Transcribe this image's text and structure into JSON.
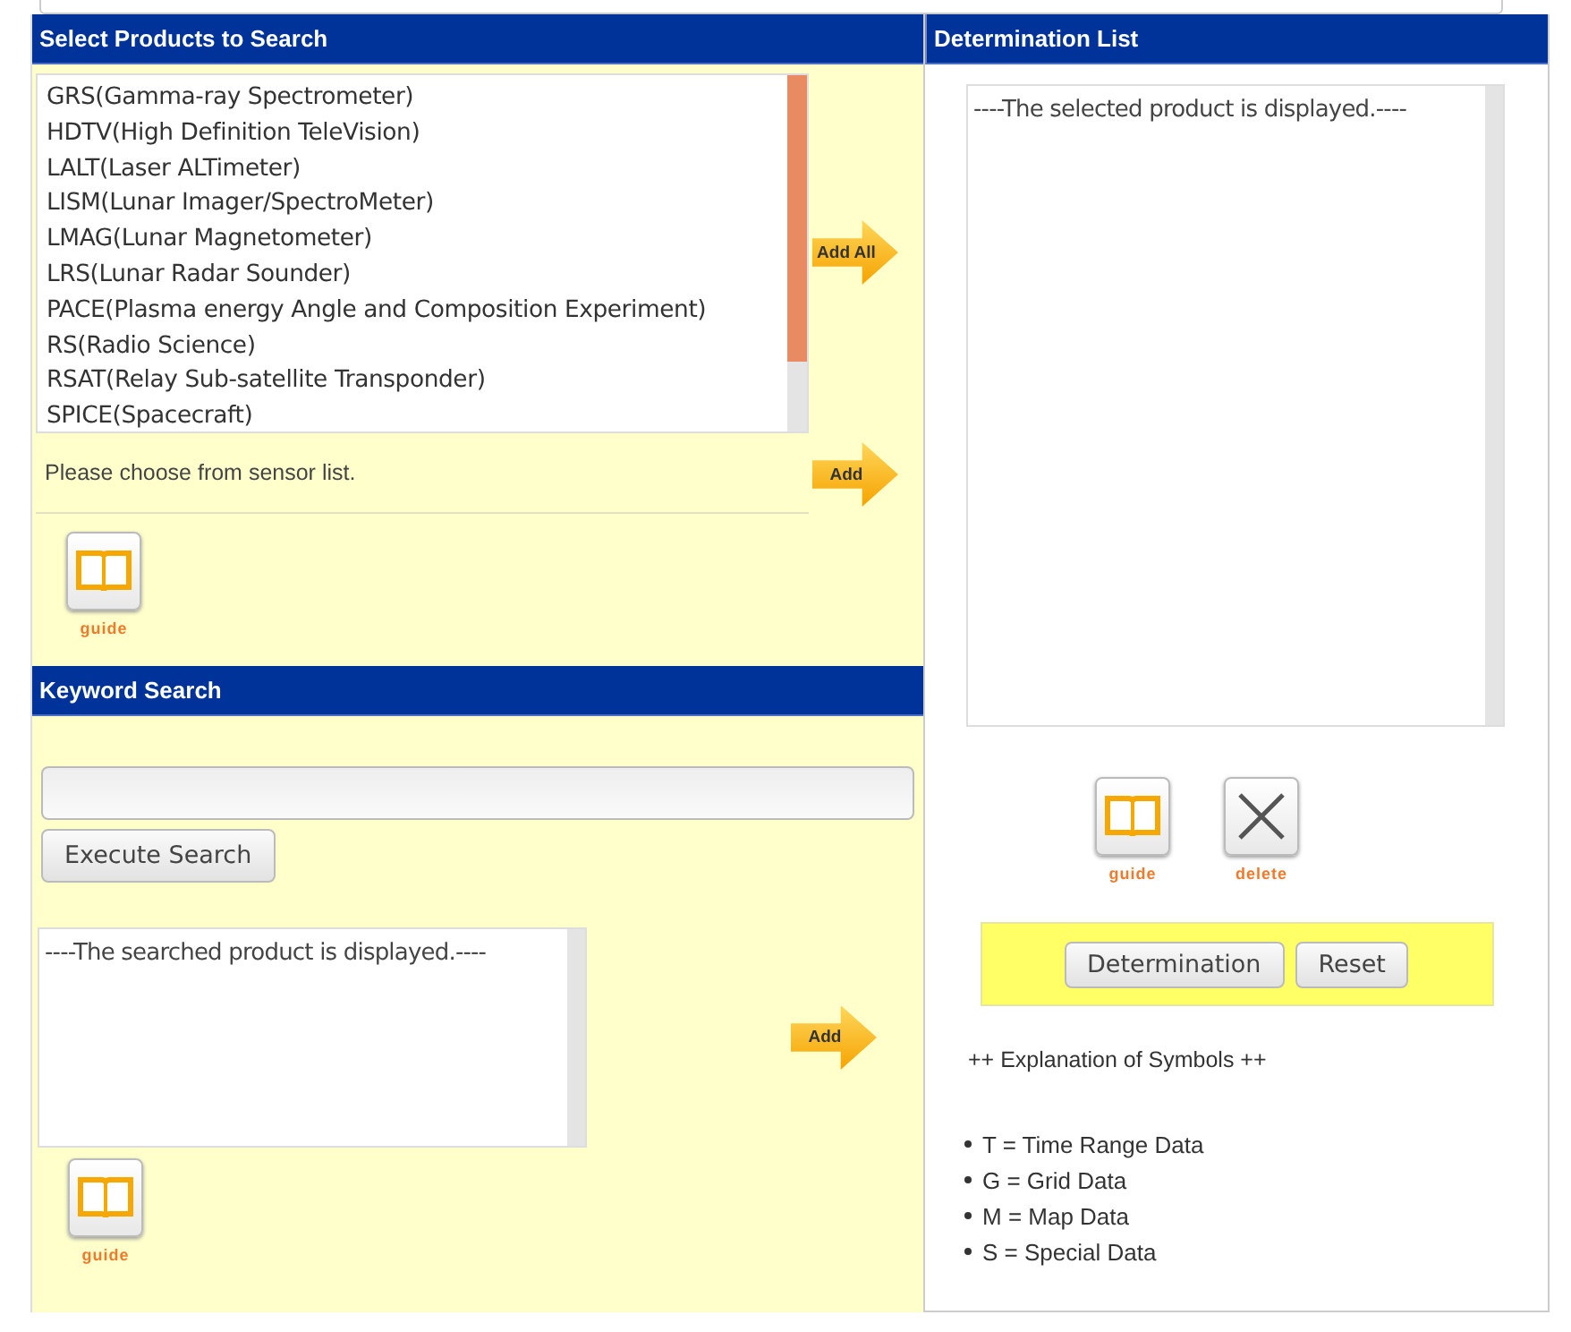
{
  "select_panel": {
    "title": "Select Products to Search",
    "products": [
      {
        "label": "GRS(Gamma-ray Spectrometer)",
        "selected": false
      },
      {
        "label": "HDTV(High Definition TeleVision)",
        "selected": false
      },
      {
        "label": "LALT(Laser ALTimeter)",
        "selected": false
      },
      {
        "label": "LISM(Lunar Imager/SpectroMeter)",
        "selected": false
      },
      {
        "label": "LMAG(Lunar Magnetometer)",
        "selected": false
      },
      {
        "label": "LRS(Lunar Radar Sounder)",
        "selected": false
      },
      {
        "label": "PACE(Plasma energy Angle and Composition Experiment)",
        "selected": false
      },
      {
        "label": "RS(Radio Science)",
        "selected": false
      },
      {
        "label": "RSAT(Relay Sub-satellite Transponder)",
        "selected": false
      },
      {
        "label": "SPICE(Spacecraft)",
        "selected": false
      }
    ],
    "hint": "Please choose from sensor list.",
    "add_all_button": "Add All",
    "add_button": "Add",
    "guide_label": "guide"
  },
  "keyword_panel": {
    "title": "Keyword Search",
    "execute_button": "Execute Search",
    "results_text": "----The searched product is displayed.----",
    "add_button": "Add",
    "guide_label": "guide"
  },
  "determination_panel": {
    "title": "Determination List",
    "list_text": "----The selected product is displayed.----",
    "guide_label": "guide",
    "delete_label": "delete",
    "determination_button": "Determination",
    "reset_button": "Reset",
    "legend_title": "++ Explanation of Symbols ++",
    "legend": [
      "T = Time Range Data",
      "G = Grid Data",
      "M = Map Data",
      "S = Special Data"
    ]
  }
}
